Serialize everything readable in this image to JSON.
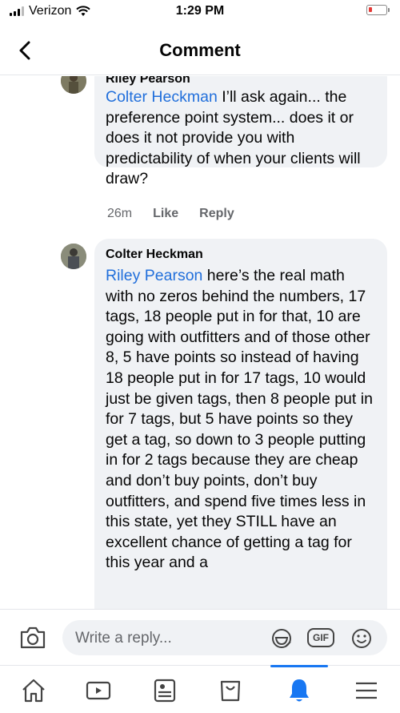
{
  "status_bar": {
    "carrier": "Verizon",
    "time": "1:29 PM"
  },
  "header": {
    "title": "Comment"
  },
  "comments": [
    {
      "author": "Riley Pearson",
      "mention": "Colter Heckman",
      "text": " I’ll ask again... the preference point system... does it or does it not provide you with predictability of when your clients will draw?",
      "time": "26m",
      "like_label": "Like",
      "reply_label": "Reply"
    },
    {
      "author": "Colter Heckman",
      "mention": "Riley Pearson",
      "text": " here’s the real math with no zeros behind the numbers, 17 tags, 18 people put in for that, 10 are going with outfitters and of those other 8, 5 have points so instead of having 18 people put in for 17 tags, 10 would just be given tags, then 8 people put in for 7 tags, but 5 have points so they get a tag, so down to 3 people putting in for 2 tags because they are cheap and don’t buy points, don’t buy outfitters, and spend five times less in this state, yet they STILL have an excellent chance of getting a tag for this year and a"
    }
  ],
  "reply_bar": {
    "placeholder": "Write a reply...",
    "gif_label": "GIF"
  },
  "tab_bar": {
    "items": [
      "home",
      "watch",
      "news",
      "marketplace",
      "notifications",
      "menu"
    ],
    "active": "notifications"
  },
  "colors": {
    "accent": "#1877f2",
    "mention": "#216fdb",
    "bubble": "#f0f2f5",
    "battery_low": "#e53935"
  }
}
